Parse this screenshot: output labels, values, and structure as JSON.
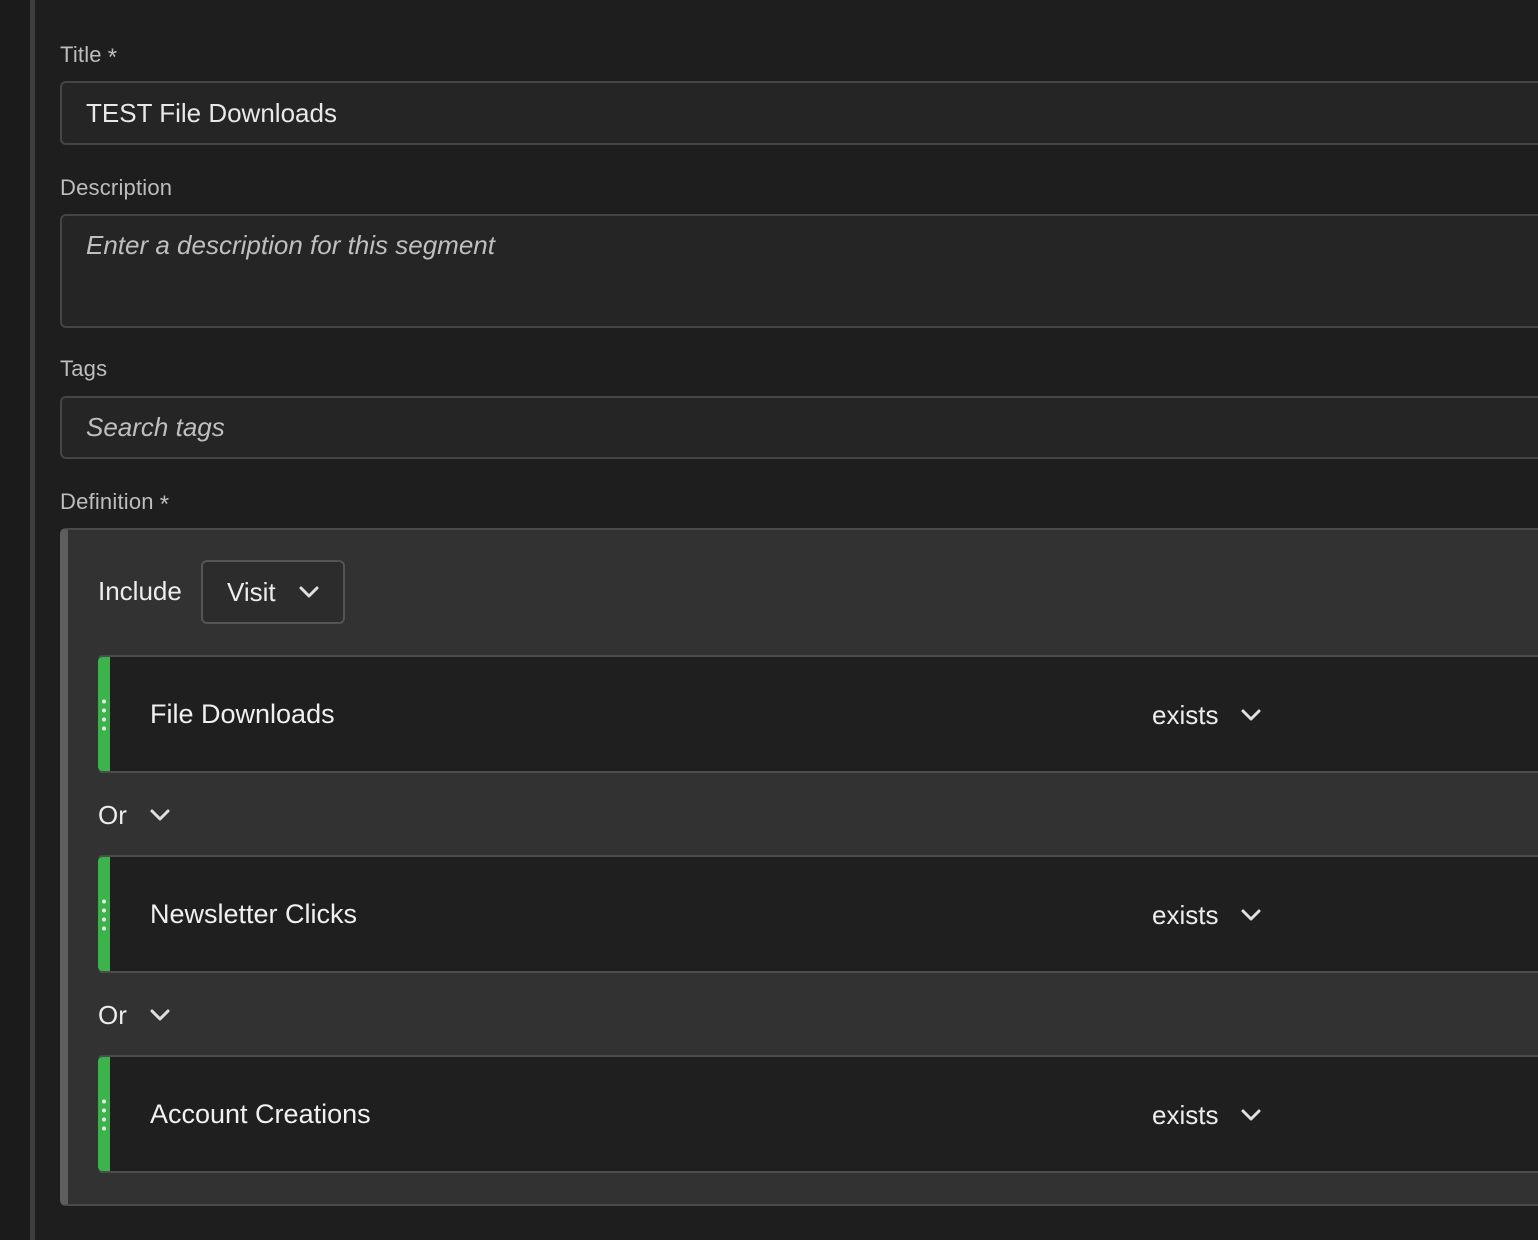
{
  "form": {
    "title_label": "Title",
    "title_required": "*",
    "title_value": "TEST File Downloads",
    "description_label": "Description",
    "description_placeholder": "Enter a description for this segment",
    "tags_label": "Tags",
    "tags_placeholder": "Search tags",
    "definition_label": "Definition",
    "definition_required": "*"
  },
  "definition": {
    "include_label": "Include",
    "scope": "Visit",
    "rules": [
      {
        "name": "File Downloads",
        "operator": "exists"
      },
      {
        "name": "Newsletter Clicks",
        "operator": "exists"
      },
      {
        "name": "Account Creations",
        "operator": "exists"
      }
    ],
    "connectors": [
      "Or",
      "Or"
    ]
  },
  "colors": {
    "background": "#1e1e1e",
    "container": "#323232",
    "rule_accent": "#3bb24a",
    "field_border": "#454545"
  },
  "icons": {
    "chevron": "chevron-down-icon",
    "drag": "drag-handle-icon"
  }
}
